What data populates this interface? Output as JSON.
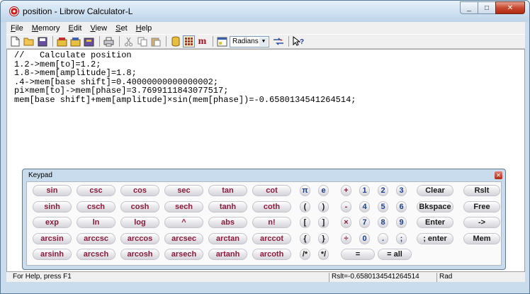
{
  "window": {
    "title": "position - Librow Calculator-L",
    "controls": {
      "minimize": "_",
      "maximize": "□",
      "close": "✕"
    }
  },
  "menu": [
    {
      "pre": "",
      "u": "F",
      "post": "ile"
    },
    {
      "pre": "",
      "u": "M",
      "post": "emory"
    },
    {
      "pre": "",
      "u": "E",
      "post": "dit"
    },
    {
      "pre": "",
      "u": "V",
      "post": "iew"
    },
    {
      "pre": "",
      "u": "S",
      "post": "et"
    },
    {
      "pre": "",
      "u": "H",
      "post": "elp"
    }
  ],
  "toolbar": {
    "angle_mode": "Radians",
    "m_label": "m"
  },
  "editor": {
    "lines": [
      "//   Calculate position",
      "1.2->mem[to]=1.2;",
      "1.8->mem[amplitude]=1.8;",
      ".4->mem[base shift]=0.40000000000000002;",
      "pi×mem[to]->mem[phase]=3.7699111843077517;",
      "mem[base shift]+mem[amplitude]×sin(mem[phase])=-0.6580134541264514;"
    ]
  },
  "status": {
    "help": "For Help, press F1",
    "result": "Rslt=-0.6580134541264514",
    "mode": "Rad"
  },
  "keypad": {
    "title": "Keypad",
    "close": "✕",
    "rows": [
      {
        "fn": [
          "sin",
          "csc",
          "cos",
          "sec",
          "tan",
          "cot"
        ],
        "ops": [
          "π",
          "e",
          "+",
          "1",
          "2",
          "3"
        ],
        "big": [
          "Clear",
          "Rslt"
        ]
      },
      {
        "fn": [
          "sinh",
          "csch",
          "cosh",
          "sech",
          "tanh",
          "coth"
        ],
        "ops": [
          "(",
          ")",
          "-",
          "4",
          "5",
          "6"
        ],
        "big": [
          "Bkspace",
          "Free"
        ]
      },
      {
        "fn": [
          "exp",
          "ln",
          "log",
          "^",
          "abs",
          "n!"
        ],
        "ops": [
          "[",
          "]",
          "×",
          "7",
          "8",
          "9"
        ],
        "big": [
          "Enter",
          "->"
        ]
      },
      {
        "fn": [
          "arcsin",
          "arccsc",
          "arccos",
          "arcsec",
          "arctan",
          "arccot"
        ],
        "ops": [
          "{",
          "}",
          "÷",
          "0",
          ".",
          ";"
        ],
        "big": [
          "; enter",
          "Mem"
        ]
      },
      {
        "fn": [
          "arsinh",
          "arcsch",
          "arcosh",
          "arsech",
          "artanh",
          "arcoth"
        ],
        "ops": [
          "/*",
          "*/"
        ],
        "mid": [
          "=",
          "= all"
        ]
      }
    ]
  }
}
